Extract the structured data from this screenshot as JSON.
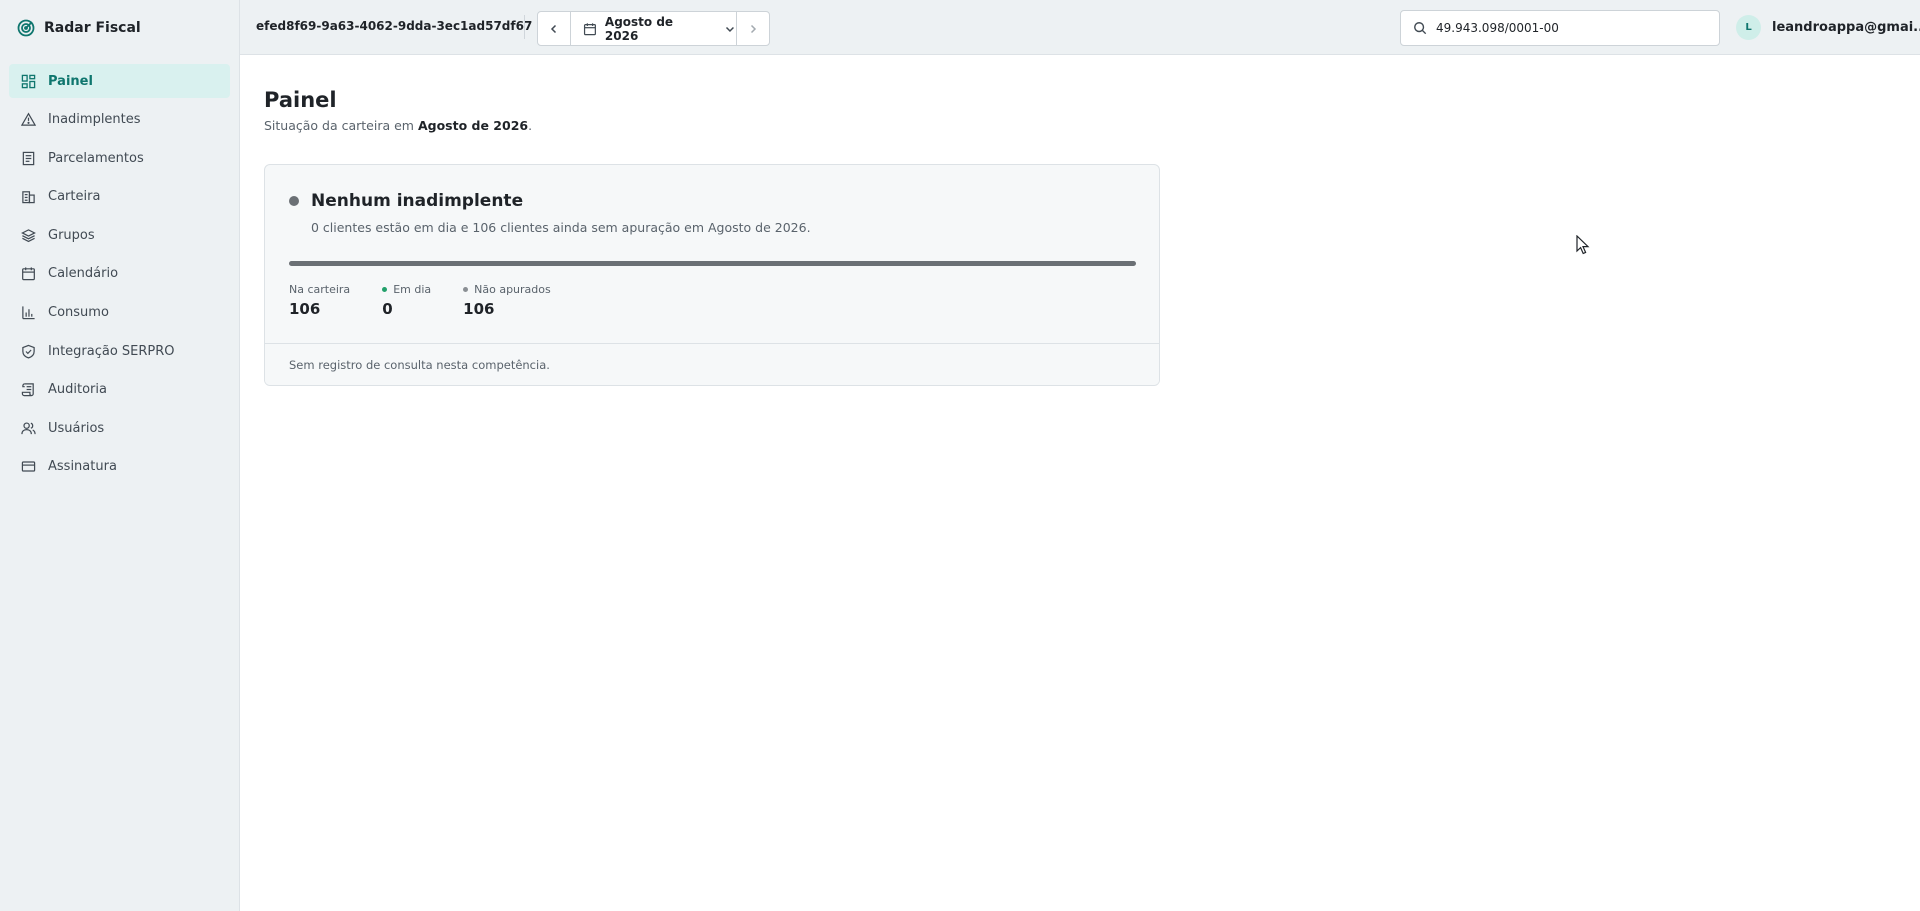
{
  "app": {
    "name": "Radar Fiscal"
  },
  "sidebar": {
    "items": [
      {
        "label": "Painel",
        "icon": "dashboard-icon",
        "active": true
      },
      {
        "label": "Inadimplentes",
        "icon": "alert-triangle-icon"
      },
      {
        "label": "Parcelamentos",
        "icon": "document-list-icon"
      },
      {
        "label": "Carteira",
        "icon": "building-icon"
      },
      {
        "label": "Grupos",
        "icon": "layers-icon"
      },
      {
        "label": "Calendário",
        "icon": "calendar-icon"
      },
      {
        "label": "Consumo",
        "icon": "bar-chart-icon"
      },
      {
        "label": "Integração SERPRO",
        "icon": "shield-check-icon"
      },
      {
        "label": "Auditoria",
        "icon": "scroll-icon"
      },
      {
        "label": "Usuários",
        "icon": "users-icon"
      },
      {
        "label": "Assinatura",
        "icon": "credit-card-icon"
      }
    ]
  },
  "header": {
    "org_id": "efed8f69-9a63-4062-9dda-3ec1ad57df67",
    "period": "Agosto de 2026",
    "search_value": "49.943.098/0001-00",
    "user_initial": "L",
    "user_email": "leandroappa@gmai..."
  },
  "main": {
    "title": "Painel",
    "subtitle_prefix": "Situação da carteira em ",
    "subtitle_period": "Agosto de 2026",
    "subtitle_suffix": ".",
    "card": {
      "title": "Nenhum inadimplente",
      "description": "0 clientes estão em dia e 106 clientes ainda sem apuração em Agosto de 2026.",
      "status_color": "#6b7075",
      "progress_fraction_not_assessed": 1.0,
      "stats": [
        {
          "label": "Na carteira",
          "value": "106",
          "dot_color": ""
        },
        {
          "label": "Em dia",
          "value": "0",
          "dot_color": "#22a06b"
        },
        {
          "label": "Não apurados",
          "value": "106",
          "dot_color": "#8a8f94"
        }
      ],
      "footer": "Sem registro de consulta nesta competência."
    }
  },
  "colors": {
    "accent": "#0f766e",
    "active_bg": "#d9f1ef",
    "sidebar_bg": "#edf1f3"
  }
}
